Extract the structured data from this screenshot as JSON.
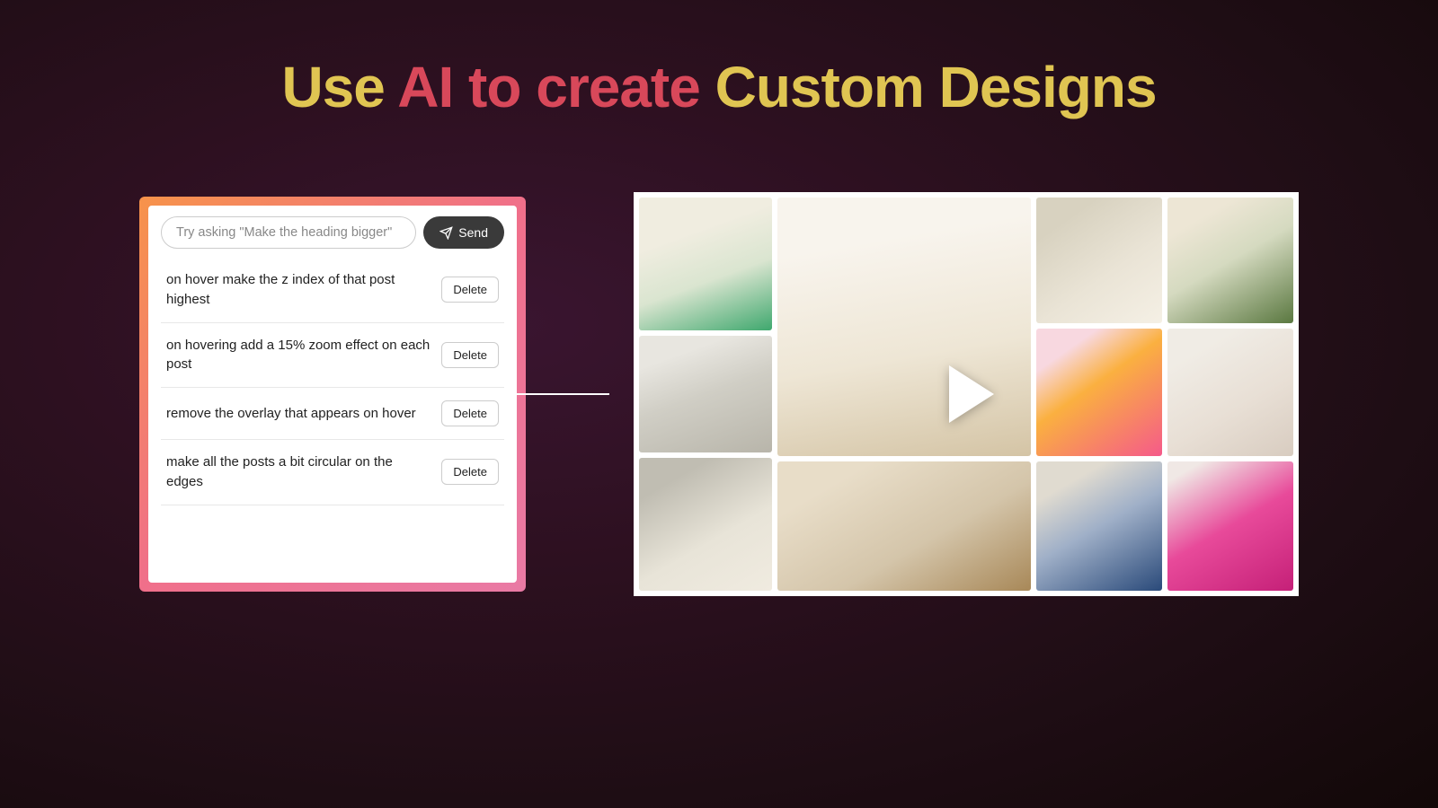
{
  "title": {
    "part1": "Use ",
    "part2": "AI to create ",
    "part3": "Custom Designs"
  },
  "chat": {
    "placeholder": "Try asking \"Make the heading bigger\"",
    "send_label": "Send",
    "delete_label": "Delete",
    "prompts": [
      "on hover make the z index of that post highest",
      "on hovering add a 15% zoom effect on each post",
      "remove the overlay that appears on hover",
      "make all the posts a bit circular on the edges"
    ]
  }
}
